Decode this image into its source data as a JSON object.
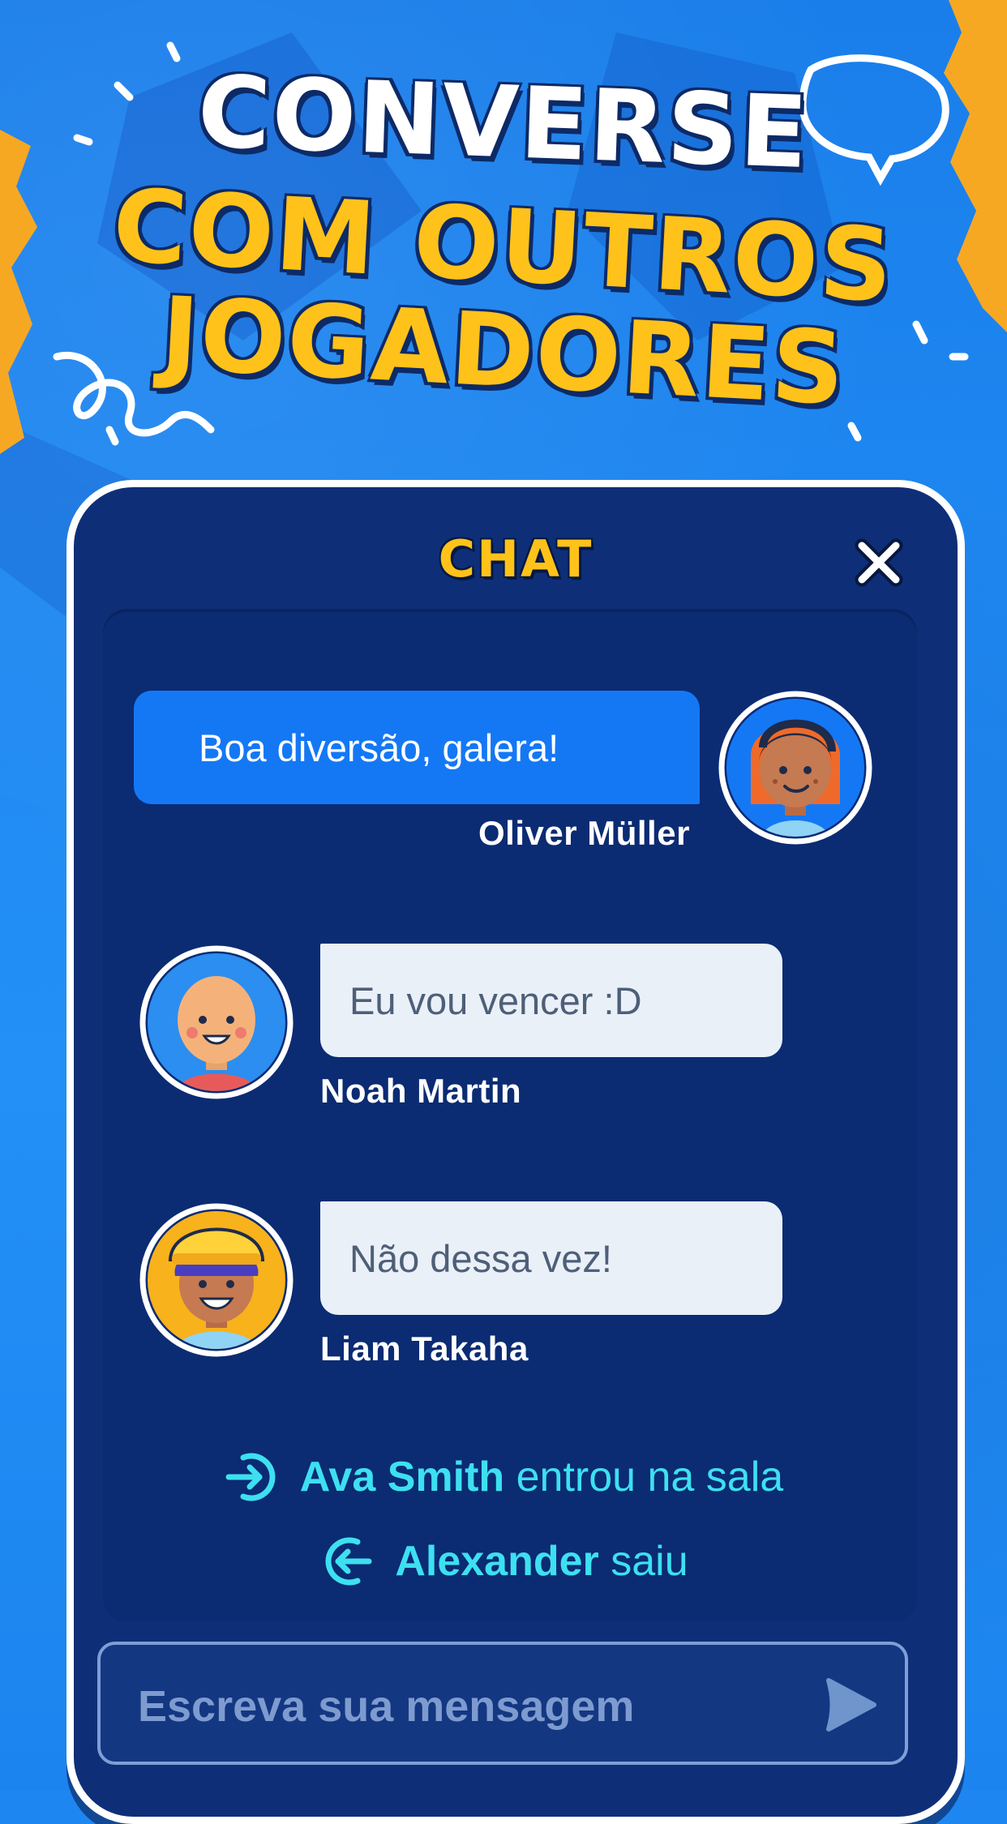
{
  "headline": {
    "line1": "CONVERSE",
    "line2": "COM OUTROS",
    "line3": "JOGADORES"
  },
  "chat": {
    "title": "CHAT",
    "messages": [
      {
        "author": "Oliver Müller",
        "text": "Boa diversão, galera!",
        "own": true
      },
      {
        "author": "Noah Martin",
        "text": "Eu vou vencer :D",
        "own": false
      },
      {
        "author": "Liam Takaha",
        "text": "Não dessa vez!",
        "own": false
      }
    ],
    "events": [
      {
        "name": "Ava Smith",
        "action": "entrou na sala"
      },
      {
        "name": "Alexander",
        "action": "saiu"
      }
    ],
    "input": {
      "placeholder": "Escreva sua mensagem"
    }
  },
  "colors": {
    "background": "#1e86f0",
    "panel": "#0e2f78",
    "accent_yellow": "#ffc21a",
    "own_bubble": "#1478f5",
    "other_bubble": "#eaf0f8",
    "event_text": "#3de0f0"
  },
  "icons": [
    "close-icon",
    "enter-icon",
    "exit-icon",
    "send-icon",
    "speech-bubble-icon"
  ]
}
